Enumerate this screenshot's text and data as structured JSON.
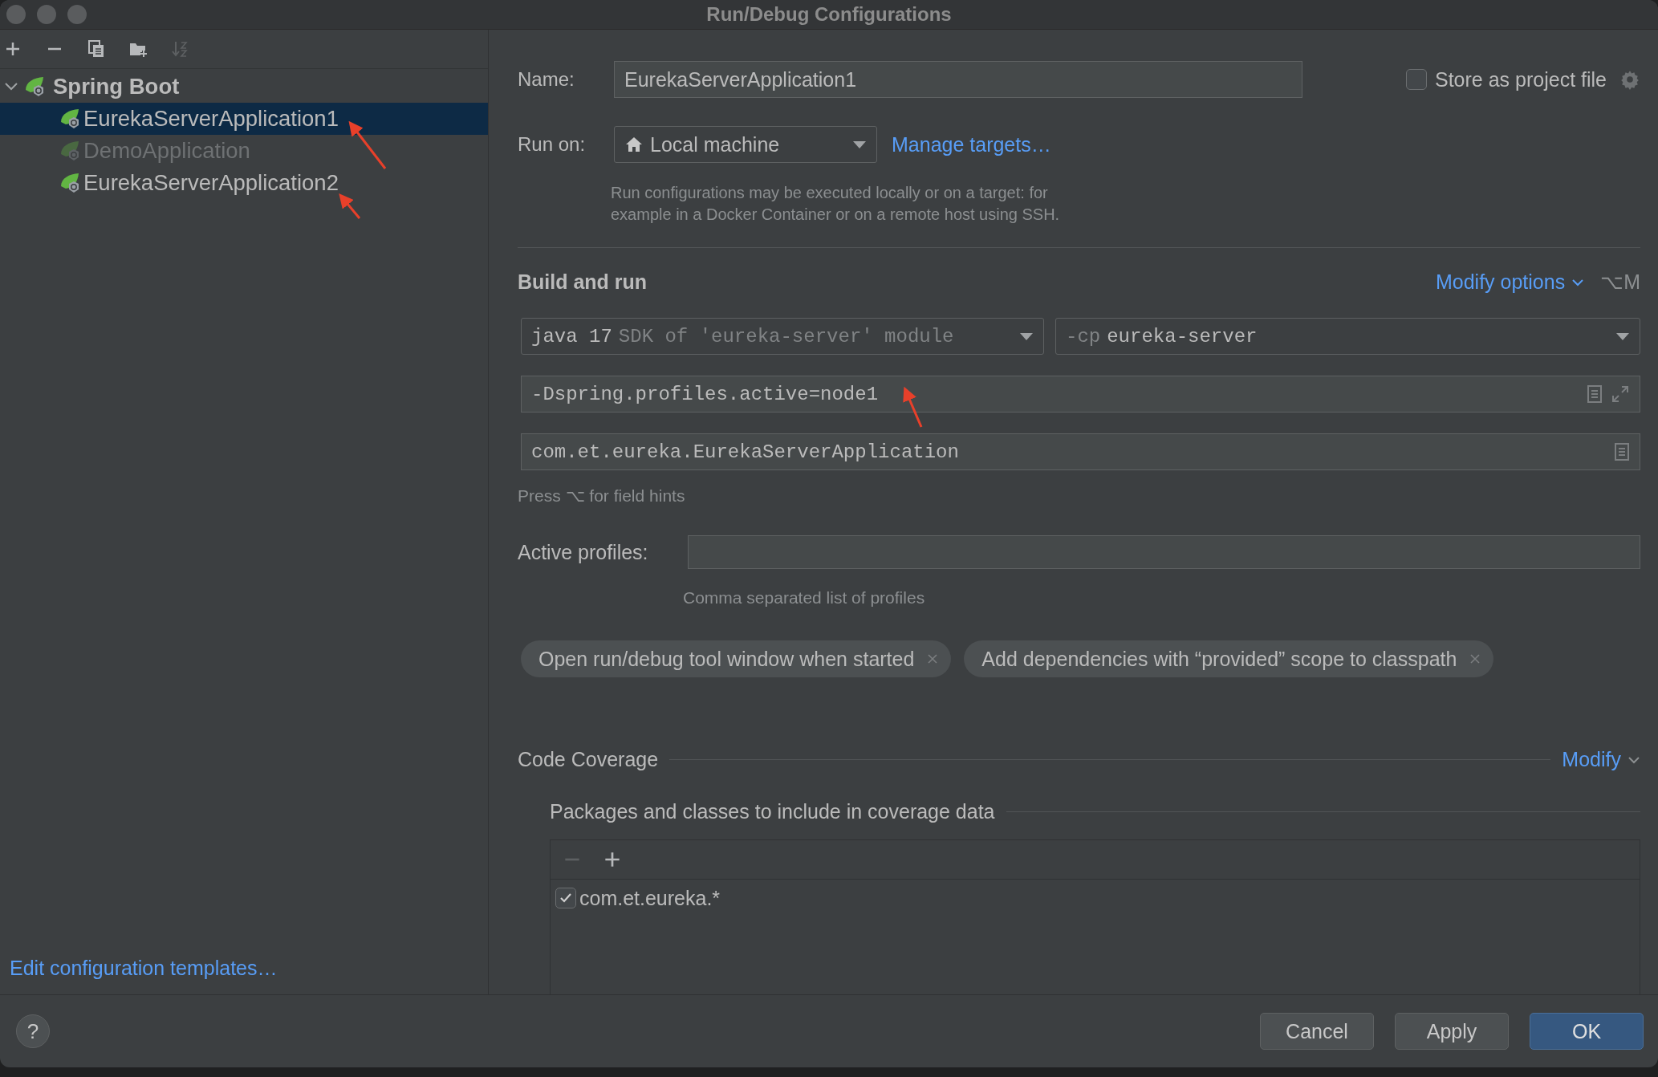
{
  "window": {
    "title": "Run/Debug Configurations"
  },
  "toolbar": [
    {
      "kind": "add",
      "disabled": false
    },
    {
      "kind": "remove",
      "disabled": false
    },
    {
      "kind": "copy",
      "disabled": false
    },
    {
      "kind": "folder",
      "disabled": false
    },
    {
      "kind": "sort",
      "disabled": true
    }
  ],
  "tree": {
    "label": "Spring Boot",
    "expanded": true,
    "children": [
      {
        "label": "EurekaServerApplication1",
        "selected": true,
        "disabled": false
      },
      {
        "label": "DemoApplication",
        "selected": false,
        "disabled": true
      },
      {
        "label": "EurekaServerApplication2",
        "selected": false,
        "disabled": false
      }
    ]
  },
  "name": {
    "label": "Name:",
    "value": "EurekaServerApplication1"
  },
  "store_as_project_file": {
    "label": "Store as project file",
    "checked": false
  },
  "run_on": {
    "label": "Run on:",
    "value": "Local machine",
    "link": "Manage targets…",
    "hint_lines": [
      "Run configurations may be executed locally or on a target: for",
      "example in a Docker Container or on a remote host using SSH."
    ]
  },
  "build_and_run": {
    "title": "Build and run",
    "modify_options": "Modify options",
    "shortcut": "⌥M",
    "sdk": {
      "value": "java 17",
      "detail": "SDK of 'eureka-server' module"
    },
    "classpath": {
      "prefix": "-cp",
      "value": "eureka-server"
    },
    "vm_options": "-Dspring.profiles.active=node1",
    "main_class": "com.et.eureka.EurekaServerApplication",
    "field_hint": "Press ⌥ for field hints"
  },
  "active_profiles": {
    "label": "Active profiles:",
    "hint": "Comma separated list of profiles"
  },
  "options": [
    {
      "label": "Open run/debug tool window when started"
    },
    {
      "label": "Add dependencies with “provided” scope to classpath"
    }
  ],
  "code_coverage": {
    "title": "Code Coverage",
    "modify": "Modify",
    "packages_title": "Packages and classes to include in coverage data",
    "table_toolbar": [
      {
        "kind": "remove",
        "disabled": true
      },
      {
        "kind": "add",
        "disabled": false
      }
    ],
    "patterns": [
      {
        "label": "com.et.eureka.*",
        "checked": true
      }
    ]
  },
  "edit_templates_link": "Edit configuration templates…",
  "help": "?",
  "buttons": [
    {
      "label": "Cancel",
      "kind": "default"
    },
    {
      "label": "Apply",
      "kind": "default"
    },
    {
      "label": "OK",
      "kind": "primary"
    }
  ]
}
